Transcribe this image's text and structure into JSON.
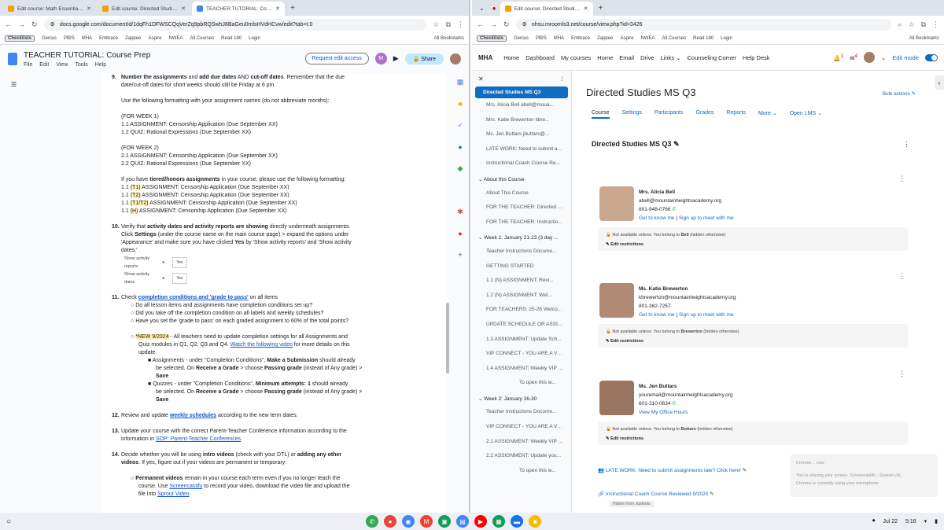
{
  "left": {
    "tabs": [
      {
        "title": "Edit course: Math Essential Ele",
        "fav": "#f4a100"
      },
      {
        "title": "Edit course: Directed Studies M",
        "fav": "#f4a100"
      },
      {
        "title": "TEACHER TUTORIAL: Course P",
        "fav": "#4285f4"
      }
    ],
    "url": "docs.google.com/document/d/1dqFh1DFWSCQqVerZq9pbRQSwhJ8BaGeu0mlsHVdHCvw/edit?tab=t.0",
    "doc": {
      "title": "TEACHER TUTORIAL: Course Prep",
      "menu": [
        "File",
        "Edit",
        "View",
        "Tools",
        "Help"
      ],
      "request_edit": "Request edit access",
      "share": "Share",
      "avatar": "M"
    },
    "content": {
      "i9_num": "9.",
      "i9_a": "Number the assignments",
      "i9_b": " and ",
      "i9_c": "add due dates",
      "i9_d": " AND ",
      "i9_e": "cut-off dates",
      "i9_f": ". Remember that the due",
      "i9_l2": "date/cut-off dates for short weeks should still be Friday at 6 pm.",
      "fmt": "Use the following formatting with your assignment names (do not abbreviate months):",
      "w1": "(FOR WEEK 1)",
      "w1a": "1.1  ASSIGNMENT: Censorship Application (Due September XX)",
      "w1b": "1.2 QUIZ: Rational Expressions (Due September XX)",
      "w2": "(FOR WEEK 2)",
      "w2a": "2.1  ASSIGNMENT: Censorship Application (Due September XX)",
      "w2b": "2.2 QUIZ: Rational Expressions (Due September XX)",
      "tier_a": "If you have ",
      "tier_b": "tiered/honors assignments",
      "tier_c": " in your course, please use the following formatting:",
      "t1_pre": "1.1 ",
      "t1_hl": "(T1)",
      "t1_post": " ASSIGNMENT: Censorship Application (Due September XX)",
      "t2_pre": "1.1 ",
      "t2_hl": "(T2)",
      "t2_post": " ASSIGNMENT: Censorship Application (Due September XX)",
      "t3_pre": "1.1 ",
      "t3_hl": "(T1/T2)",
      "t3_post": " ASSIGNMENT: Censorship Application (Due September XX)",
      "t4_pre": "1.1 ",
      "t4_hl": "(H)",
      "t4_post": " ASSIGNMENT: Censorship Application (Due September XX)",
      "i10_num": "10.",
      "i10_a": "Verify that ",
      "i10_b": "activity dates and activity reports are showing",
      "i10_c": " directly underneath assignments.",
      "i10_l2a": "Click ",
      "i10_l2b": "Settings",
      "i10_l2c": " (under the course name on the main course page) > expand the options under",
      "i10_l3a": "'Appearance' and make sure you have clicked ",
      "i10_l3b": "Yes",
      "i10_l3c": " by 'Show activity reports' and 'Show activity",
      "i10_l4": "dates.'",
      "set1": "Show activity reports",
      "set2": "Show activity dates",
      "set_val": "Yes",
      "i11_num": "11.",
      "i11_a": "Check ",
      "i11_link": "completion conditions and 'grade to pass'",
      "i11_b": " on all items",
      "b1": "Do all lesson items and assignments have completion conditions set up?",
      "b2": "Did you take off the completion condition on all labels and weekly schedules?",
      "b3": "Have you set the 'grade to pass' on each graded assignment to 60% of the total points?",
      "new_hl": "*NEW 9/2024",
      "new_a": " - All teachers need to update completion settings for all Assignments and",
      "new_l2a": "Quiz modules in Q1, Q2, Q3 and Q4. ",
      "new_link": "Watch the following video",
      "new_l2b": " for more details on this",
      "new_l3": "update.",
      "s1_a": "Assignments - under \"Completion Conditions\", ",
      "s1_b": "Make a Submission",
      "s1_c": " should already",
      "s1_l2a": "be selected. On ",
      "s1_l2b": "Receive a Grade",
      "s1_l2c": " > choose ",
      "s1_l2d": "Passing grade",
      "s1_l2e": " (instead of Any grade) >",
      "s1_l3": "Save",
      "s2_a": "Quizzes -  under \"Completion Conditions\", ",
      "s2_b": "Minimum attempts: 1",
      "s2_c": " should already",
      "s2_l2a": "be selected. On ",
      "s2_l2b": "Receive a Grade",
      "s2_l2c": " > choose ",
      "s2_l2d": "Passing grade",
      "s2_l2e": " (instead of Any grade) >",
      "s2_l3": "Save",
      "i12_num": "12.",
      "i12_a": "Review and update ",
      "i12_link": "weekly schedules",
      "i12_b": " according to the new term dates.",
      "i13_num": "13.",
      "i13_a": "Update your course with the correct Parent-Teacher Conference information according to the",
      "i13_l2a": "information in ",
      "i13_link": "SOP: Parent-Teacher Conferences",
      "i13_l2b": ".",
      "i14_num": "14.",
      "i14_a": "Decide whether you will be using ",
      "i14_b": "intro videos",
      "i14_c": " (check with your DTL) or ",
      "i14_d": "adding any other",
      "i14_l2a": "videos",
      "i14_l2b": ". If yes, figure out if your videos are permanent or temporary:",
      "pv_a": "Permanent videos",
      "pv_b": " remain in your course each term even if you no longer teach the",
      "pv_l2a": "course. Use ",
      "pv_link": "Screencastify",
      "pv_l2b": " to record your video, download the video file and upload the",
      "pv_l3a": "file into ",
      "pv_link2": "Sprout Video",
      "pv_l3b": "."
    }
  },
  "right": {
    "tab": "Edit course: Directed Studies M",
    "url": "ohsu.mroomls3.net/course/view.php?id=3426",
    "nav": [
      "MHA",
      "Home",
      "Dashboard",
      "My courses",
      "Home",
      "Email",
      "Drive",
      "Links",
      "Counseling Corner",
      "Help Desk"
    ],
    "edit_mode": "Edit mode",
    "notif_count": "1",
    "msg_count": "4",
    "course_title": "Directed Studies MS Q3",
    "bulk_actions": "Bulk actions",
    "tabs": [
      "Course",
      "Settings",
      "Participants",
      "Grades",
      "Reports",
      "More",
      "Open LMS"
    ],
    "section_title": "Directed Studies MS Q3",
    "index": {
      "course": "Directed Studies MS Q3",
      "items0": [
        "Mrs. Alicia Bell abell@moua...",
        "Mrs. Katie Brewerton kbre...",
        "Ms. Jen Buttars jbuttars@...",
        "LATE WORK: Need to submit a...",
        "Instructional Coach Course Re..."
      ],
      "sec1": "About this Course",
      "items1": [
        "About This Course",
        "FOR THE TEACHER: Directed S...",
        "FOR THE TEACHER: Instructio..."
      ],
      "sec2": "Week 1: January 21-23 (3 day ...",
      "items2": [
        "Teacher Instructions Docume...",
        "GETTING STARTED",
        "1.1 (N) ASSIGNMENT: Revi...",
        "1.2 (N) ASSIGNMENT: Wel...",
        "FOR TEACHERS: 25-26 Welco...",
        "UPDATE SCHEDULE OR ASSIG...",
        "1.3 ASSIGNMENT: Update Sch...",
        "VIP CONNECT - YOU ARE A VE...",
        "1.4 ASSIGNMENT: Weekly VIP ...",
        "To open this w..."
      ],
      "sec3": "Week 2: January 26-30",
      "items3": [
        "Teacher Instructions Docume...",
        "VIP CONNECT - YOU ARE A VE...",
        "2.1 ASSIGNMENT: Weekly VIP ...",
        "2.2 ASSIGNMENT: Update you...",
        "To open this w..."
      ]
    },
    "teachers": [
      {
        "name": "Mrs. Alicia Bell",
        "email": "abell@mountainheightsacademy.org",
        "phone": "801-948-0766",
        "link1": "Get to know me",
        "link2": "Sign up to meet with me",
        "restr_a": "Not available unless: You belong to ",
        "restr_b": "Bell",
        "restr_c": " (hidden otherwise)",
        "edit": "Edit restrictions"
      },
      {
        "name": "Ms. Katie Brewerton",
        "email": "kbrewerton@mountainheightsacademy.org",
        "phone": "801-382-7257",
        "link1": "Get to know me",
        "link2": "Sign up to meet with me",
        "restr_a": "Not available unless: You belong to ",
        "restr_b": "Brewerton",
        "restr_c": " (hidden otherwise)",
        "edit": "Edit restrictions"
      },
      {
        "name": "Ms. Jen Buttars",
        "email": "youremail@mountainheightsacademy.org",
        "phone": "801-210-0634",
        "link1": "View My Office Hours",
        "link2": "",
        "restr_a": "Not available unless: You belong to ",
        "restr_b": "Buttars",
        "restr_c": " (hidden otherwise)",
        "edit": "Edit restrictions"
      }
    ],
    "late_work": "LATE WORK: Need to submit assignments late? Click here!",
    "coach": "Instructional Coach Course Reviewed 9/2020",
    "coach_tag": "Hidden from students",
    "toast": {
      "l1": "Chrome... now",
      "l2": "You're sharing your screen. Screencastify - Screen vid...",
      "l3": "Chrome is currently using your microphone"
    }
  },
  "bookmarks": [
    "Checklists",
    "Genius",
    "PBIS",
    "MHA",
    "Embrace",
    "Zappee",
    "Aspire",
    "NWEA",
    "All Courses",
    "Read 180",
    "Login",
    "All Bookmarks"
  ],
  "taskbar": {
    "date": "Jul 22",
    "time": "5:16"
  }
}
